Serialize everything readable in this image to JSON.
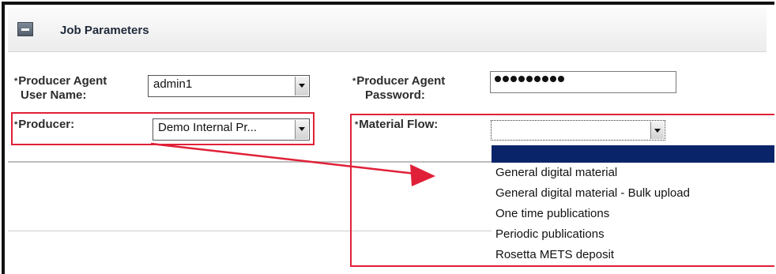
{
  "panel": {
    "title": "Job Parameters",
    "collapse_icon": "minus-icon"
  },
  "required_marker": "*",
  "fields": {
    "producer_agent_user_name": {
      "label_line1": "Producer Agent",
      "label_line2": "User Name:",
      "value": "admin1"
    },
    "producer_agent_password": {
      "label_line1": "Producer Agent",
      "label_line2": "Password:",
      "masked_length": 9
    },
    "producer": {
      "label": "Producer:",
      "value": "Demo Internal Pr..."
    },
    "material_flow": {
      "label": "Material Flow:",
      "value": "",
      "options": [
        "",
        "General digital material",
        "General digital material - Bulk upload",
        "One time publications",
        "Periodic publications",
        "Rosetta METS deposit"
      ],
      "highlighted_index": 0
    }
  },
  "annotation": {
    "highlight_color": "#e02038",
    "arrow_color": "#e02038"
  },
  "colors": {
    "selection": "#0a246a",
    "frame": "#111111"
  }
}
